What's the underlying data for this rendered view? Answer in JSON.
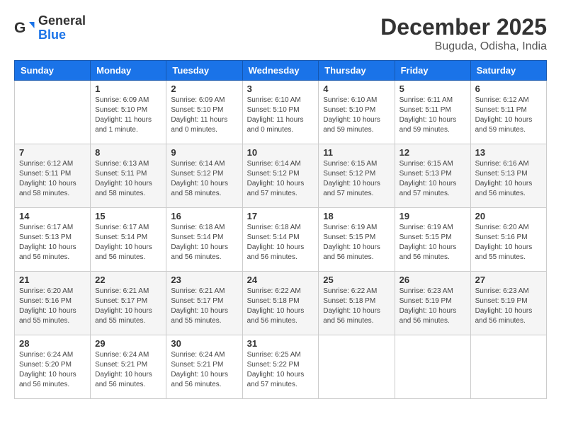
{
  "header": {
    "logo_general": "General",
    "logo_blue": "Blue",
    "month": "December 2025",
    "location": "Buguda, Odisha, India"
  },
  "weekdays": [
    "Sunday",
    "Monday",
    "Tuesday",
    "Wednesday",
    "Thursday",
    "Friday",
    "Saturday"
  ],
  "weeks": [
    [
      {
        "day": "",
        "info": ""
      },
      {
        "day": "1",
        "info": "Sunrise: 6:09 AM\nSunset: 5:10 PM\nDaylight: 11 hours\nand 1 minute."
      },
      {
        "day": "2",
        "info": "Sunrise: 6:09 AM\nSunset: 5:10 PM\nDaylight: 11 hours\nand 0 minutes."
      },
      {
        "day": "3",
        "info": "Sunrise: 6:10 AM\nSunset: 5:10 PM\nDaylight: 11 hours\nand 0 minutes."
      },
      {
        "day": "4",
        "info": "Sunrise: 6:10 AM\nSunset: 5:10 PM\nDaylight: 10 hours\nand 59 minutes."
      },
      {
        "day": "5",
        "info": "Sunrise: 6:11 AM\nSunset: 5:11 PM\nDaylight: 10 hours\nand 59 minutes."
      },
      {
        "day": "6",
        "info": "Sunrise: 6:12 AM\nSunset: 5:11 PM\nDaylight: 10 hours\nand 59 minutes."
      }
    ],
    [
      {
        "day": "7",
        "info": "Sunrise: 6:12 AM\nSunset: 5:11 PM\nDaylight: 10 hours\nand 58 minutes."
      },
      {
        "day": "8",
        "info": "Sunrise: 6:13 AM\nSunset: 5:11 PM\nDaylight: 10 hours\nand 58 minutes."
      },
      {
        "day": "9",
        "info": "Sunrise: 6:14 AM\nSunset: 5:12 PM\nDaylight: 10 hours\nand 58 minutes."
      },
      {
        "day": "10",
        "info": "Sunrise: 6:14 AM\nSunset: 5:12 PM\nDaylight: 10 hours\nand 57 minutes."
      },
      {
        "day": "11",
        "info": "Sunrise: 6:15 AM\nSunset: 5:12 PM\nDaylight: 10 hours\nand 57 minutes."
      },
      {
        "day": "12",
        "info": "Sunrise: 6:15 AM\nSunset: 5:13 PM\nDaylight: 10 hours\nand 57 minutes."
      },
      {
        "day": "13",
        "info": "Sunrise: 6:16 AM\nSunset: 5:13 PM\nDaylight: 10 hours\nand 56 minutes."
      }
    ],
    [
      {
        "day": "14",
        "info": "Sunrise: 6:17 AM\nSunset: 5:13 PM\nDaylight: 10 hours\nand 56 minutes."
      },
      {
        "day": "15",
        "info": "Sunrise: 6:17 AM\nSunset: 5:14 PM\nDaylight: 10 hours\nand 56 minutes."
      },
      {
        "day": "16",
        "info": "Sunrise: 6:18 AM\nSunset: 5:14 PM\nDaylight: 10 hours\nand 56 minutes."
      },
      {
        "day": "17",
        "info": "Sunrise: 6:18 AM\nSunset: 5:14 PM\nDaylight: 10 hours\nand 56 minutes."
      },
      {
        "day": "18",
        "info": "Sunrise: 6:19 AM\nSunset: 5:15 PM\nDaylight: 10 hours\nand 56 minutes."
      },
      {
        "day": "19",
        "info": "Sunrise: 6:19 AM\nSunset: 5:15 PM\nDaylight: 10 hours\nand 56 minutes."
      },
      {
        "day": "20",
        "info": "Sunrise: 6:20 AM\nSunset: 5:16 PM\nDaylight: 10 hours\nand 55 minutes."
      }
    ],
    [
      {
        "day": "21",
        "info": "Sunrise: 6:20 AM\nSunset: 5:16 PM\nDaylight: 10 hours\nand 55 minutes."
      },
      {
        "day": "22",
        "info": "Sunrise: 6:21 AM\nSunset: 5:17 PM\nDaylight: 10 hours\nand 55 minutes."
      },
      {
        "day": "23",
        "info": "Sunrise: 6:21 AM\nSunset: 5:17 PM\nDaylight: 10 hours\nand 55 minutes."
      },
      {
        "day": "24",
        "info": "Sunrise: 6:22 AM\nSunset: 5:18 PM\nDaylight: 10 hours\nand 56 minutes."
      },
      {
        "day": "25",
        "info": "Sunrise: 6:22 AM\nSunset: 5:18 PM\nDaylight: 10 hours\nand 56 minutes."
      },
      {
        "day": "26",
        "info": "Sunrise: 6:23 AM\nSunset: 5:19 PM\nDaylight: 10 hours\nand 56 minutes."
      },
      {
        "day": "27",
        "info": "Sunrise: 6:23 AM\nSunset: 5:19 PM\nDaylight: 10 hours\nand 56 minutes."
      }
    ],
    [
      {
        "day": "28",
        "info": "Sunrise: 6:24 AM\nSunset: 5:20 PM\nDaylight: 10 hours\nand 56 minutes."
      },
      {
        "day": "29",
        "info": "Sunrise: 6:24 AM\nSunset: 5:21 PM\nDaylight: 10 hours\nand 56 minutes."
      },
      {
        "day": "30",
        "info": "Sunrise: 6:24 AM\nSunset: 5:21 PM\nDaylight: 10 hours\nand 56 minutes."
      },
      {
        "day": "31",
        "info": "Sunrise: 6:25 AM\nSunset: 5:22 PM\nDaylight: 10 hours\nand 57 minutes."
      },
      {
        "day": "",
        "info": ""
      },
      {
        "day": "",
        "info": ""
      },
      {
        "day": "",
        "info": ""
      }
    ]
  ]
}
